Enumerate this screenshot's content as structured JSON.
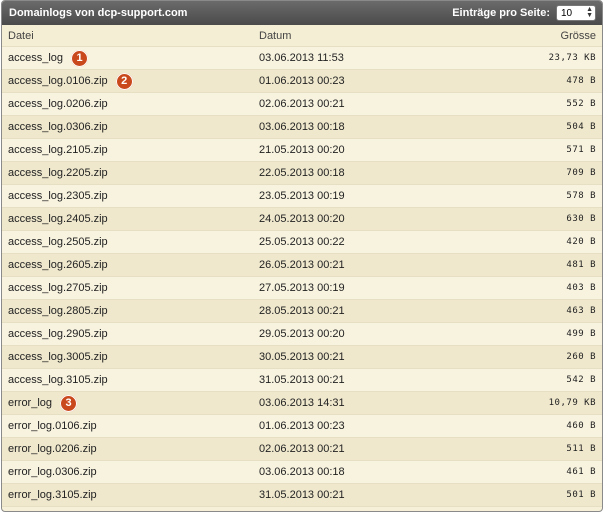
{
  "title": "Domainlogs von dcp-support.com",
  "per_page": {
    "label": "Einträge pro Seite:",
    "value": "10"
  },
  "columns": {
    "name": "Datei",
    "date": "Datum",
    "size": "Grösse"
  },
  "rows": [
    {
      "name": "access_log",
      "date": "03.06.2013 11:53",
      "size": "23,73 KB",
      "badge": "1"
    },
    {
      "name": "access_log.0106.zip",
      "date": "01.06.2013 00:23",
      "size": "478 B",
      "badge": "2"
    },
    {
      "name": "access_log.0206.zip",
      "date": "02.06.2013 00:21",
      "size": "552 B"
    },
    {
      "name": "access_log.0306.zip",
      "date": "03.06.2013 00:18",
      "size": "504 B"
    },
    {
      "name": "access_log.2105.zip",
      "date": "21.05.2013 00:20",
      "size": "571 B"
    },
    {
      "name": "access_log.2205.zip",
      "date": "22.05.2013 00:18",
      "size": "709 B"
    },
    {
      "name": "access_log.2305.zip",
      "date": "23.05.2013 00:19",
      "size": "578 B"
    },
    {
      "name": "access_log.2405.zip",
      "date": "24.05.2013 00:20",
      "size": "630 B"
    },
    {
      "name": "access_log.2505.zip",
      "date": "25.05.2013 00:22",
      "size": "420 B"
    },
    {
      "name": "access_log.2605.zip",
      "date": "26.05.2013 00:21",
      "size": "481 B"
    },
    {
      "name": "access_log.2705.zip",
      "date": "27.05.2013 00:19",
      "size": "403 B"
    },
    {
      "name": "access_log.2805.zip",
      "date": "28.05.2013 00:21",
      "size": "463 B"
    },
    {
      "name": "access_log.2905.zip",
      "date": "29.05.2013 00:20",
      "size": "499 B"
    },
    {
      "name": "access_log.3005.zip",
      "date": "30.05.2013 00:21",
      "size": "260 B"
    },
    {
      "name": "access_log.3105.zip",
      "date": "31.05.2013 00:21",
      "size": "542 B"
    },
    {
      "name": "error_log",
      "date": "03.06.2013 14:31",
      "size": "10,79 KB",
      "badge": "3"
    },
    {
      "name": "error_log.0106.zip",
      "date": "01.06.2013 00:23",
      "size": "460 B"
    },
    {
      "name": "error_log.0206.zip",
      "date": "02.06.2013 00:21",
      "size": "511 B"
    },
    {
      "name": "error_log.0306.zip",
      "date": "03.06.2013 00:18",
      "size": "461 B"
    },
    {
      "name": "error_log.3105.zip",
      "date": "31.05.2013 00:21",
      "size": "501 B"
    }
  ],
  "colors": {
    "badge": "#c9481c",
    "titlebar": "#555555",
    "row_odd": "#f8f3df",
    "row_even": "#efe8cd"
  }
}
